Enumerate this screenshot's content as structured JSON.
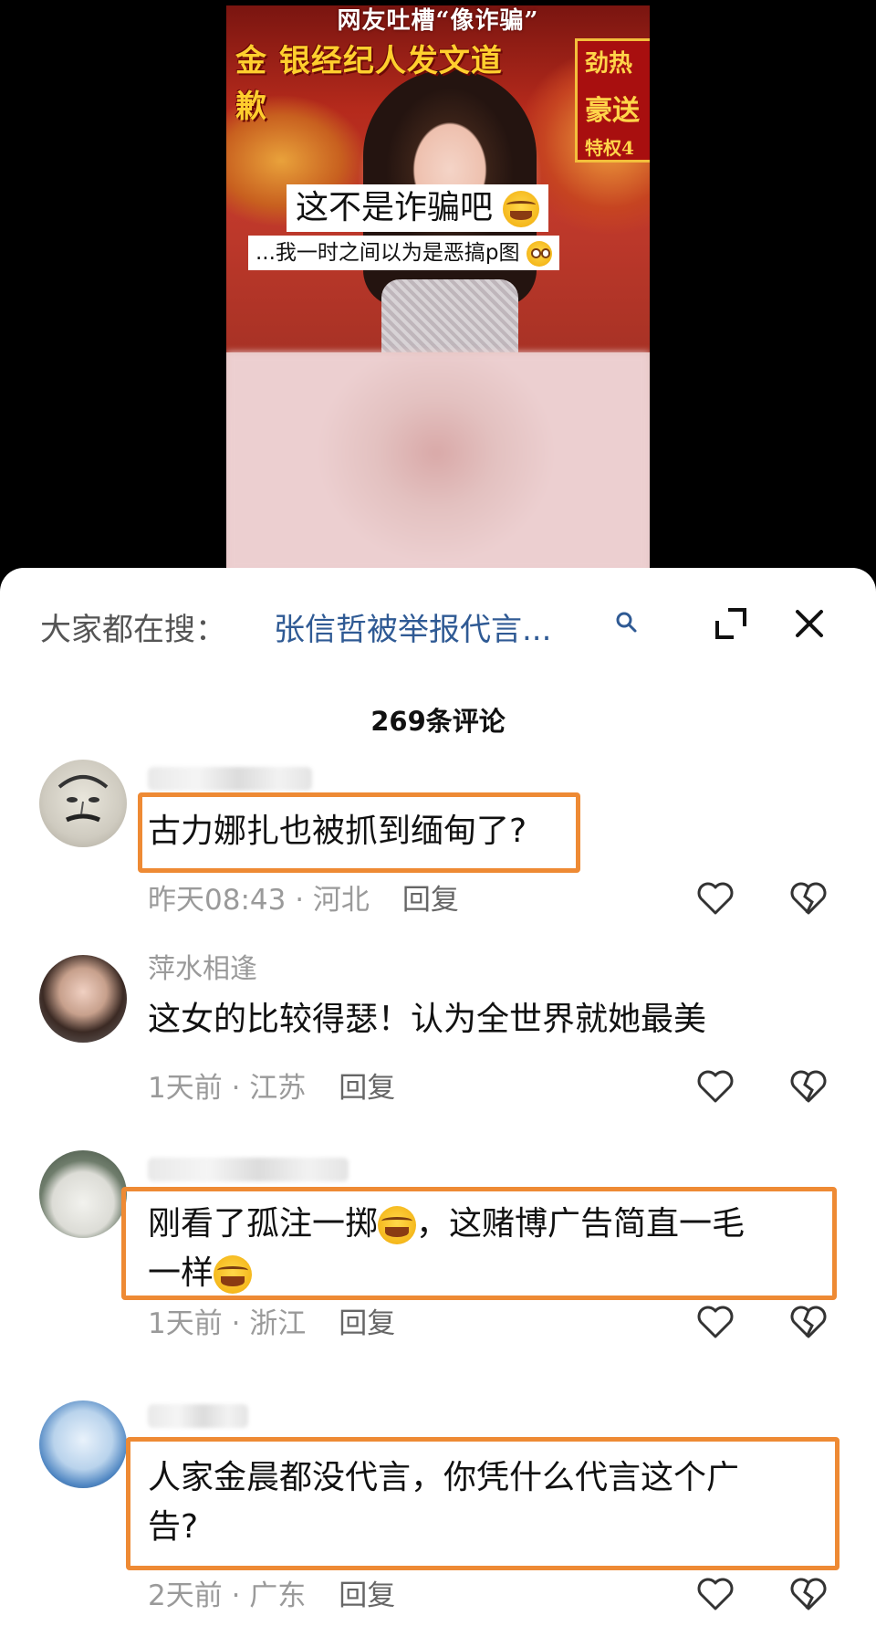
{
  "video": {
    "headline_top": "网友吐槽“像诈骗”",
    "headline_main": "金 银经纪人发文道歉",
    "side_badge": [
      "劲热",
      "豪送",
      "特权4"
    ],
    "caption_1": "这不是诈骗吧",
    "caption_2": "...我一时之间以为是恶搞p图"
  },
  "search": {
    "prefix": "大家都在搜：",
    "term": "张信哲被举报代言..."
  },
  "comments_count": "269条评论",
  "comments": [
    {
      "username": "",
      "text": "古力娜扎也被抓到缅甸了?",
      "time": "昨天08:43",
      "location": "河北",
      "reply": "回复",
      "highlighted": true
    },
    {
      "username": "萍水相逢",
      "text": "这女的比较得瑟！认为全世界就她最美",
      "time": "1天前",
      "location": "江苏",
      "reply": "回复",
      "highlighted": false
    },
    {
      "username": "",
      "text_part1": "刚看了孤注一掷",
      "text_part2": "，这赌博广告简直一毛",
      "text_part3": "一样",
      "time": "1天前",
      "location": "浙江",
      "reply": "回复",
      "highlighted": true
    },
    {
      "username": "",
      "text_line1": "人家金晨都没代言，你凭什么代言这个广",
      "text_line2": "告?",
      "time": "2天前",
      "location": "广东",
      "reply": "回复",
      "highlighted": true
    }
  ],
  "separator": " · ",
  "icons": {
    "search": "search-icon",
    "expand": "expand-icon",
    "close": "close-icon",
    "like": "heart-icon",
    "dislike": "broken-heart-icon"
  },
  "colors": {
    "highlight": "#ee8a34",
    "search_term": "#2f5a94"
  }
}
